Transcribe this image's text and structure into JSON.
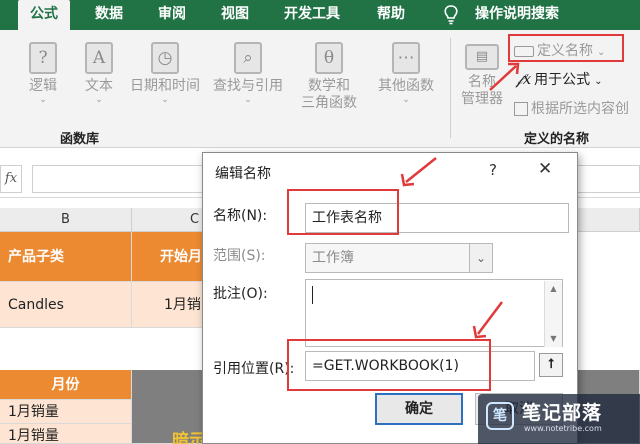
{
  "ribbon": {
    "tabs": [
      {
        "label": "公式",
        "active": true
      },
      {
        "label": "数据"
      },
      {
        "label": "审阅"
      },
      {
        "label": "视图"
      },
      {
        "label": "开发工具"
      },
      {
        "label": "帮助"
      },
      {
        "label": "操作说明搜索"
      }
    ],
    "function_library": {
      "buttons": [
        {
          "label": "逻辑",
          "icon": "?"
        },
        {
          "label": "文本",
          "icon": "A"
        },
        {
          "label": "日期和时间",
          "icon": ""
        },
        {
          "label": "查找与引用",
          "icon": ""
        },
        {
          "label": "数学和\n三角函数",
          "icon": "θ"
        },
        {
          "label": "其他函数",
          "icon": ""
        }
      ],
      "group_label": "函数库"
    },
    "defined_names": {
      "name_manager_label": "名称\n管理器",
      "define_name": "定义名称",
      "use_in_formula": "用于公式",
      "create_from_selection": "根据所选内容创",
      "group_label": "定义的名称"
    }
  },
  "formula_bar": {
    "fx_label": "fx"
  },
  "sheet": {
    "col_b": "B",
    "col_c": "C",
    "header_b": "产品子类",
    "header_c": "开始月",
    "row1_b": "Candles",
    "row1_c": "1月销",
    "months_header": "月份",
    "months": [
      "1月销量",
      "1月销量"
    ],
    "bottom_text": "暗示作表汇总条件成格"
  },
  "dialog": {
    "title": "编辑名称",
    "help": "?",
    "close": "✕",
    "name_label": "名称(N):",
    "name_value": "工作表名称",
    "scope_label": "范围(S):",
    "scope_value": "工作簿",
    "comment_label": "批注(O):",
    "comment_value": "",
    "refers_label": "引用位置(R):",
    "refers_value": "=GET.WORKBOOK(1)",
    "ok": "确定",
    "cancel": "取消"
  },
  "watermark": {
    "name": "笔记部落",
    "url": "www.notetribe.com"
  },
  "colors": {
    "ribbon_green": "#217346",
    "header_orange": "#ec8a32",
    "cell_peach": "#fde4d3",
    "annotation_red": "#e03a3a"
  }
}
